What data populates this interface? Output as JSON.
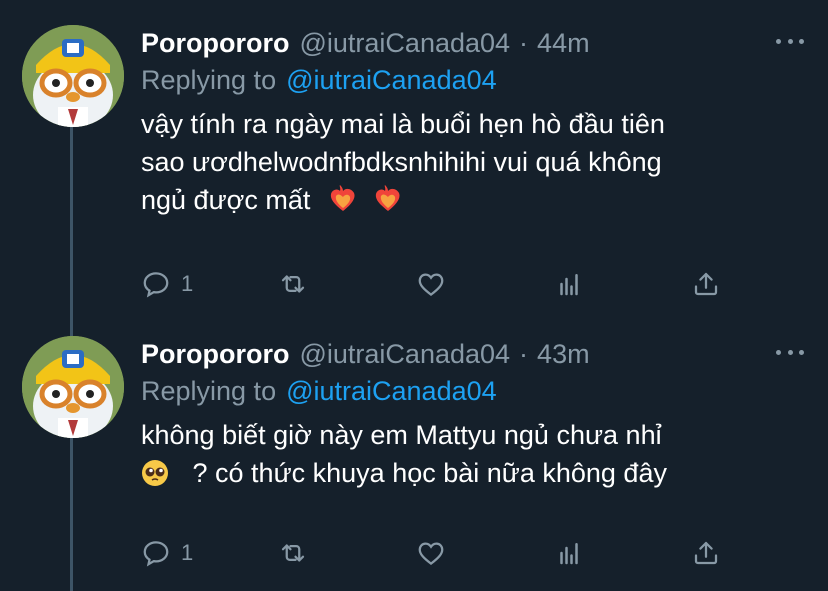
{
  "tweets": [
    {
      "display_name": "Poropororo",
      "handle": "@iutraiCanada04",
      "separator": "·",
      "time": "44m",
      "replying_prefix": "Replying to",
      "replying_to": "@iutraiCanada04",
      "lines": [
        "vậy tính ra ngày mai là buổi hẹn hò đầu tiên",
        "sao ươdhelwodnfbdksnhihihi vui quá không",
        "ngủ được mất"
      ],
      "emojis": [
        "heart-on-fire",
        "heart-on-fire"
      ],
      "reply_count": "1",
      "retweet_count": "",
      "like_count": ""
    },
    {
      "display_name": "Poropororo",
      "handle": "@iutraiCanada04",
      "separator": "·",
      "time": "43m",
      "replying_prefix": "Replying to",
      "replying_to": "@iutraiCanada04",
      "lines": [
        "không biết giờ này em Mattyu ngủ chưa nhỉ",
        "? có thức khuya học bài nữa không đây"
      ],
      "emojis": [
        "pleading-face"
      ],
      "reply_count": "1",
      "retweet_count": "",
      "like_count": ""
    }
  ],
  "colors": {
    "background": "#15202b",
    "secondary_text": "#8899a6",
    "link": "#1da1f2",
    "thread_line": "#3d5466"
  },
  "icons": [
    "reply-icon",
    "retweet-icon",
    "like-icon",
    "analytics-icon",
    "share-icon",
    "more-icon"
  ]
}
